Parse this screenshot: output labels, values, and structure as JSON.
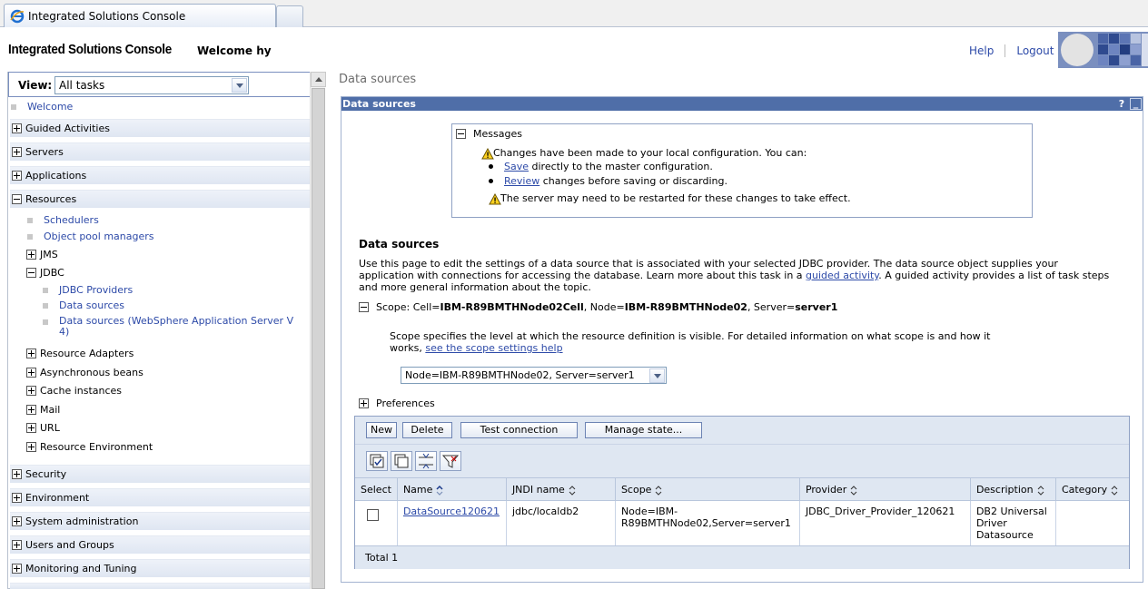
{
  "browser": {
    "tab_title": "Integrated Solutions Console"
  },
  "header": {
    "brand": "Integrated Solutions Console",
    "welcome": "Welcome hy",
    "help": "Help",
    "logout": "Logout"
  },
  "nav": {
    "view_label": "View:",
    "view_value": "All tasks",
    "welcome": "Welcome",
    "guided_activities": "Guided Activities",
    "servers": "Servers",
    "applications": "Applications",
    "resources": "Resources",
    "schedulers": "Schedulers",
    "object_pool_managers": "Object pool managers",
    "jms": "JMS",
    "jdbc": "JDBC",
    "jdbc_providers": "JDBC Providers",
    "data_sources": "Data sources",
    "data_sources_v4_line1": "Data sources (WebSphere Application Server V",
    "data_sources_v4_line2": "4)",
    "resource_adapters": "Resource Adapters",
    "async_beans": "Asynchronous beans",
    "cache_instances": "Cache instances",
    "mail": "Mail",
    "url": "URL",
    "resource_environment": "Resource Environment",
    "security": "Security",
    "environment": "Environment",
    "system_administration": "System administration",
    "users_groups": "Users and Groups",
    "monitoring": "Monitoring and Tuning"
  },
  "main": {
    "breadcrumb": "Data sources",
    "portlet_title": "Data sources",
    "help_glyph": "?",
    "minimize_glyph": "_",
    "messages": {
      "title": "Messages",
      "line1": "Changes have been made to your local configuration. You can:",
      "save_link": "Save",
      "save_rest": " directly to the master configuration.",
      "review_link": "Review",
      "review_rest": " changes before saving or discarding.",
      "restart": "The server may need to be restarted for these changes to take effect."
    },
    "section_title": "Data sources",
    "desc_part1": "Use this page to edit the settings of a data source that is associated with your selected JDBC provider. The data source object supplies your application with connections for accessing the database. Learn more about this task in a ",
    "desc_link": "guided activity",
    "desc_part2": ". A guided activity provides a list of task steps and more general information about the topic.",
    "scope": {
      "prefix": "Scope: Cell=",
      "cell": "IBM-R89BMTHNode02Cell",
      "node_label": ", Node=",
      "node": "IBM-R89BMTHNode02",
      "server_label": ", Server=",
      "server": "server1",
      "desc": "Scope specifies the level at which the resource definition is visible. For detailed information on what scope is and how it works, ",
      "desc_link": "see the scope settings help",
      "select_value": "Node=IBM-R89BMTHNode02, Server=server1"
    },
    "preferences": "Preferences",
    "buttons": {
      "new": "New",
      "delete": "Delete",
      "test": "Test connection",
      "manage": "Manage state..."
    },
    "table": {
      "headers": {
        "select": "Select",
        "name": "Name",
        "jndi": "JNDI name",
        "scope": "Scope",
        "provider": "Provider",
        "description": "Description",
        "category": "Category"
      },
      "rows": [
        {
          "name": "DataSource120621",
          "jndi": "jdbc/localdb2",
          "scope": "Node=IBM-R89BMTHNode02,Server=server1",
          "provider": "JDBC_Driver_Provider_120621",
          "description": "DB2 Universal Driver Datasource",
          "category": ""
        }
      ],
      "total": "Total 1"
    }
  }
}
